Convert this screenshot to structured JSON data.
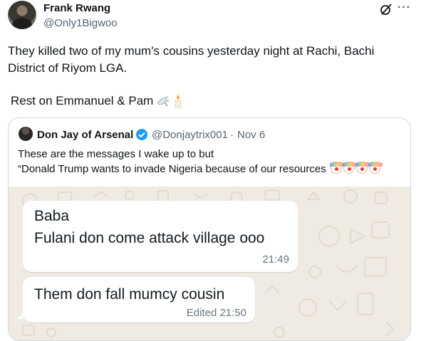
{
  "author": {
    "name": "Frank Rwang",
    "handle": "@Only1Bigwoo"
  },
  "tweet": {
    "text": "They killed two of my mum's cousins yesterday night at Rachi, Bachi District of Riyom LGA.",
    "rest_text": "Rest on  Emmanuel & Pam",
    "emojis": [
      "dove-emoji",
      "candle-emoji"
    ]
  },
  "quote": {
    "name": "Don Jay of Arsenal",
    "handle": "@Donjaytrix001",
    "separator": "·",
    "date": "Nov 6",
    "line1": "These are the messages I wake up to but",
    "line2": "“Donald Trump wants to invade Nigeria because of our resources",
    "emoji_count": 4
  },
  "chat": {
    "bubble1": {
      "line1": "Baba",
      "line2": "Fulani don come attack village ooo",
      "time": "21:49"
    },
    "bubble2": {
      "line1": "Them don fall mumcy cousin",
      "time": "Edited 21:50"
    }
  },
  "colors": {
    "verified": "#1d9bf0",
    "muted": "#536471",
    "chat_bg": "#efeae2"
  }
}
